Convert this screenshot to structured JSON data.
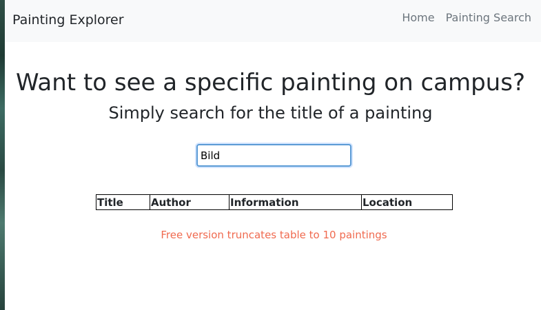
{
  "navbar": {
    "brand": "Painting Explorer",
    "links": [
      "Home",
      "Painting Search"
    ]
  },
  "hero": {
    "title": "Want to see a specific painting on campus?",
    "subtitle": "Simply search for the title of a painting"
  },
  "search": {
    "value": "Bild"
  },
  "table": {
    "columns": [
      "Title",
      "Author",
      "Information",
      "Location"
    ],
    "rows": []
  },
  "notice": "Free version truncates table to 10 paintings",
  "colors": {
    "notice": "#f06a4f",
    "input_border": "#5b9bd5",
    "navbar_bg": "#f8f9fa"
  }
}
